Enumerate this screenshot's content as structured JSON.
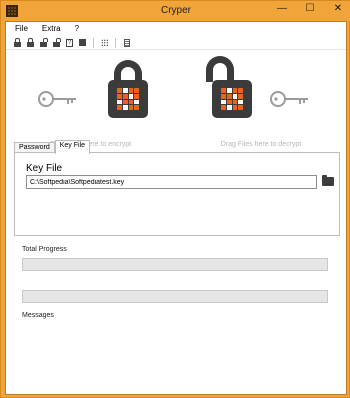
{
  "window": {
    "title": "Cryper",
    "controls": [
      "—",
      "☐",
      "✕"
    ]
  },
  "menu": [
    "File",
    "Extra",
    "?"
  ],
  "toolbar": [
    "lock-icon",
    "lock-icon",
    "unlock-icon",
    "unlock-icon",
    "help-icon",
    "stop-icon",
    "grid-icon",
    "document-icon"
  ],
  "encrypt_area": {
    "hint": "Drag Files here to encrypt"
  },
  "decrypt_area": {
    "hint": "Drag Files here to decrypt"
  },
  "tabs": [
    {
      "label": "Password",
      "active": false
    },
    {
      "label": "Key File",
      "active": true
    }
  ],
  "key_file": {
    "title": "Key File",
    "path": "C:\\Softpedia\\Softpediatest.key"
  },
  "total_progress": {
    "label": "Total Progress",
    "value": 0
  },
  "file_progress": {
    "value": 0
  },
  "messages": {
    "label": "Messages"
  },
  "colors": {
    "frame": "#f0a43a",
    "lock_accent": "#e8631f",
    "lock_body": "#3b3b3b"
  }
}
